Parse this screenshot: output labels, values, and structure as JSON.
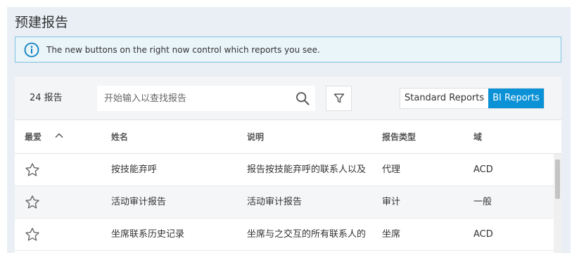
{
  "page": {
    "title": "预建报告"
  },
  "banner": {
    "message": "The new buttons on the right now control which reports you see."
  },
  "toolbar": {
    "count_label": "24 报告",
    "search_placeholder": "开始输入以查找报告",
    "toggle": {
      "standard_label": "Standard Reports",
      "bi_label": "BI Reports",
      "active": "bi"
    }
  },
  "table": {
    "columns": {
      "favorite": "最爱",
      "name": "姓名",
      "description": "说明",
      "report_type": "报告类型",
      "domain": "域"
    },
    "sort": {
      "column": "favorite",
      "direction": "ascending"
    },
    "rows": [
      {
        "favorite": false,
        "name": "按技能弃呼",
        "description": "报告按技能弃呼的联系人以及",
        "report_type": "代理",
        "domain": "ACD"
      },
      {
        "favorite": false,
        "name": "活动审计报告",
        "description": "活动审计报告",
        "report_type": "审计",
        "domain": "一般"
      },
      {
        "favorite": false,
        "name": "坐席联系历史记录",
        "description": "坐席与之交互的所有联系人的",
        "report_type": "坐席",
        "domain": "ACD"
      }
    ]
  },
  "colors": {
    "accent": "#0a91d6",
    "banner_border": "#7fc3df",
    "banner_bg": "#eaf5fa",
    "page_bg": "#e9eff5"
  },
  "icons": {
    "banner": "info-icon",
    "search": "search-icon",
    "filter": "filter-icon",
    "sort": "chevron-up-icon",
    "favorite": "star-outline-icon"
  }
}
